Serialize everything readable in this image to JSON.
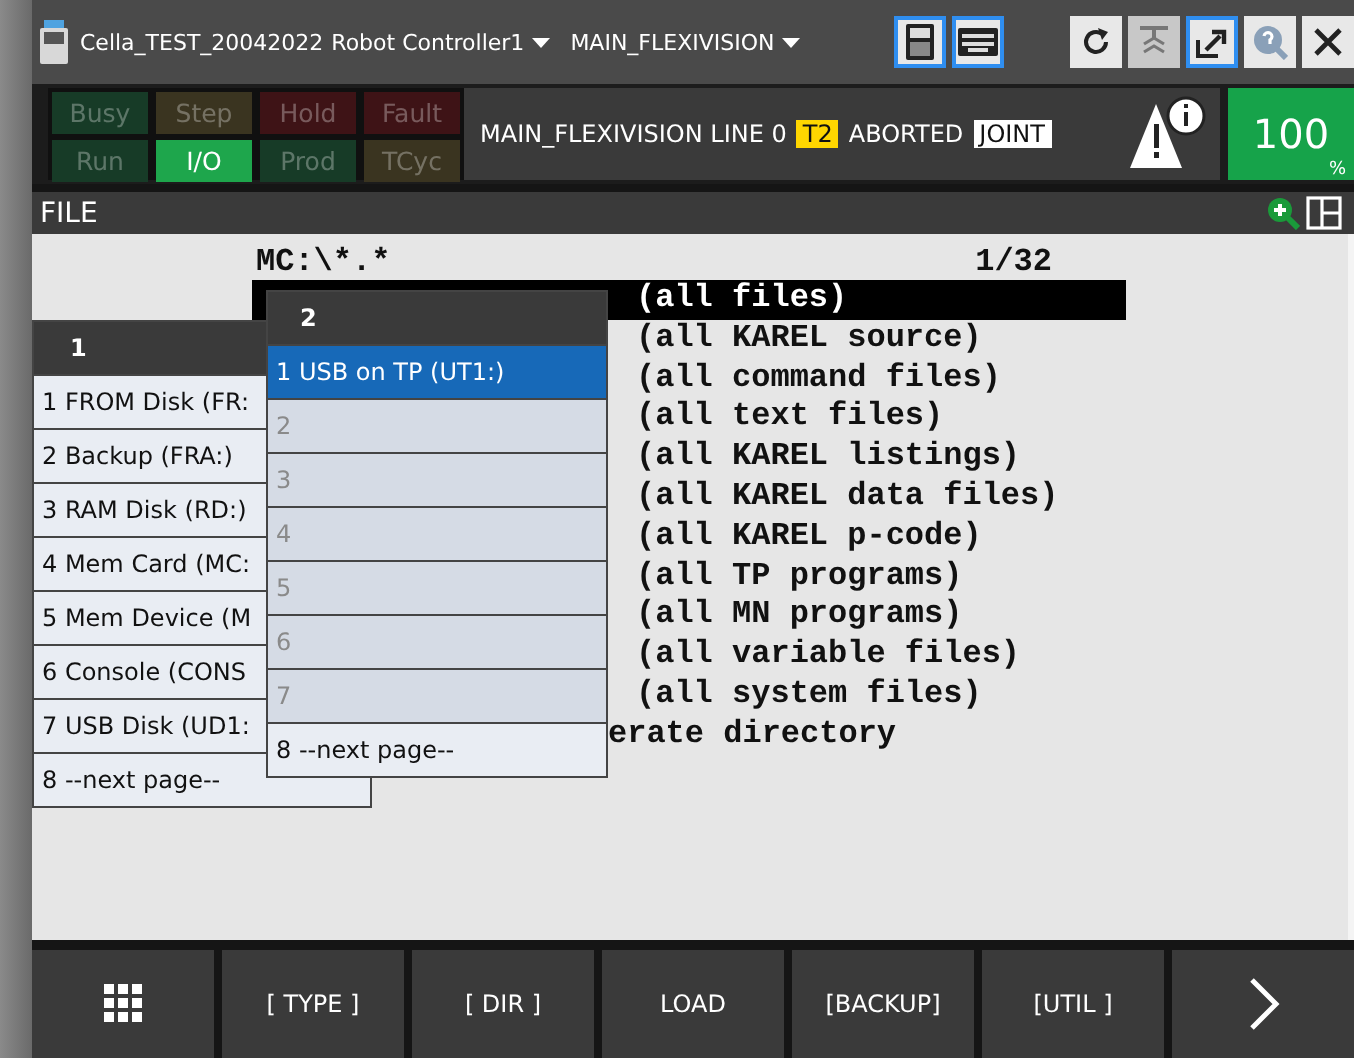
{
  "title_bar": {
    "file": "Cella_TEST_20042022",
    "controller": "Robot Controller1",
    "program": "MAIN_FLEXIVISION",
    "tools": [
      {
        "kind": "pendant",
        "on": true
      },
      {
        "kind": "keyboard",
        "on": true
      },
      {
        "kind": "refresh",
        "on": false
      },
      {
        "kind": "step",
        "on": false
      },
      {
        "kind": "export",
        "on": true
      },
      {
        "kind": "help",
        "on": false
      },
      {
        "kind": "close",
        "on": false
      }
    ]
  },
  "status_lamps": [
    {
      "label": "Busy",
      "on": false,
      "color": "#173b27"
    },
    {
      "label": "Step",
      "on": false,
      "color": "#3a3420"
    },
    {
      "label": "Hold",
      "on": false,
      "color": "#3e1316"
    },
    {
      "label": "Fault",
      "on": false,
      "color": "#3e1316"
    },
    {
      "label": "Run",
      "on": false,
      "color": "#173b27"
    },
    {
      "label": "I/O",
      "on": true,
      "color": "#1ea64c"
    },
    {
      "label": "Prod",
      "on": false,
      "color": "#173b27"
    },
    {
      "label": "TCyc",
      "on": false,
      "color": "#3a3420"
    }
  ],
  "status_line": {
    "program_line": "MAIN_FLEXIVISION LINE 0",
    "mode": "T2",
    "state": "ABORTED",
    "coord": "JOINT"
  },
  "override": {
    "value": "100",
    "unit": "%"
  },
  "screen_title": "FILE",
  "file_list": {
    "path": "MC:\\*.*",
    "position": "1/32",
    "rows": [
      {
        "text": "(all files)",
        "selected": true,
        "kind": "full"
      },
      {
        "text": "(all KAREL source)",
        "selected": false,
        "kind": "full"
      },
      {
        "text": "(all command files)",
        "selected": false,
        "kind": "full"
      },
      {
        "text": "(all text files)",
        "selected": false,
        "kind": "full"
      },
      {
        "text": "(all KAREL listings)",
        "selected": false,
        "kind": "full"
      },
      {
        "text": "(all KAREL data files)",
        "selected": false,
        "kind": "full"
      },
      {
        "text": "(all KAREL p-code)",
        "selected": false,
        "kind": "full"
      },
      {
        "text": "(all TP programs)",
        "selected": false,
        "kind": "full"
      },
      {
        "text": "(all MN programs)",
        "selected": false,
        "kind": "full"
      },
      {
        "text": "(all variable files)",
        "selected": false,
        "kind": "full"
      },
      {
        "text": "(all system files)",
        "selected": false,
        "kind": "full"
      },
      {
        "text": "erate directory",
        "selected": false,
        "kind": "cut"
      }
    ]
  },
  "device_menu_1": {
    "title": "1",
    "items": [
      {
        "label": "1 FROM Disk (FR:",
        "selected": false,
        "disabled": false
      },
      {
        "label": "2 Backup (FRA:)",
        "selected": false,
        "disabled": false
      },
      {
        "label": "3 RAM Disk (RD:)",
        "selected": false,
        "disabled": false
      },
      {
        "label": "4 Mem Card (MC:",
        "selected": false,
        "disabled": false
      },
      {
        "label": "5 Mem Device (M",
        "selected": false,
        "disabled": false
      },
      {
        "label": "6 Console (CONS",
        "selected": false,
        "disabled": false
      },
      {
        "label": "7 USB Disk (UD1:",
        "selected": false,
        "disabled": false
      },
      {
        "label": "8 --next page--",
        "selected": false,
        "disabled": false
      }
    ]
  },
  "device_menu_2": {
    "title": "2",
    "items": [
      {
        "label": "1 USB on TP (UT1:)",
        "selected": true,
        "disabled": false
      },
      {
        "label": "2",
        "selected": false,
        "disabled": true
      },
      {
        "label": "3",
        "selected": false,
        "disabled": true
      },
      {
        "label": "4",
        "selected": false,
        "disabled": true
      },
      {
        "label": "5",
        "selected": false,
        "disabled": true
      },
      {
        "label": "6",
        "selected": false,
        "disabled": true
      },
      {
        "label": "7",
        "selected": false,
        "disabled": true
      },
      {
        "label": "8 --next page--",
        "selected": false,
        "disabled": false
      }
    ]
  },
  "function_keys": [
    {
      "kind": "menu"
    },
    {
      "kind": "text",
      "label": "[ TYPE ]"
    },
    {
      "kind": "text",
      "label": "[ DIR ]"
    },
    {
      "kind": "text",
      "label": "LOAD"
    },
    {
      "kind": "text",
      "label": "[BACKUP]"
    },
    {
      "kind": "text",
      "label": "[UTIL ]"
    },
    {
      "kind": "next"
    }
  ]
}
